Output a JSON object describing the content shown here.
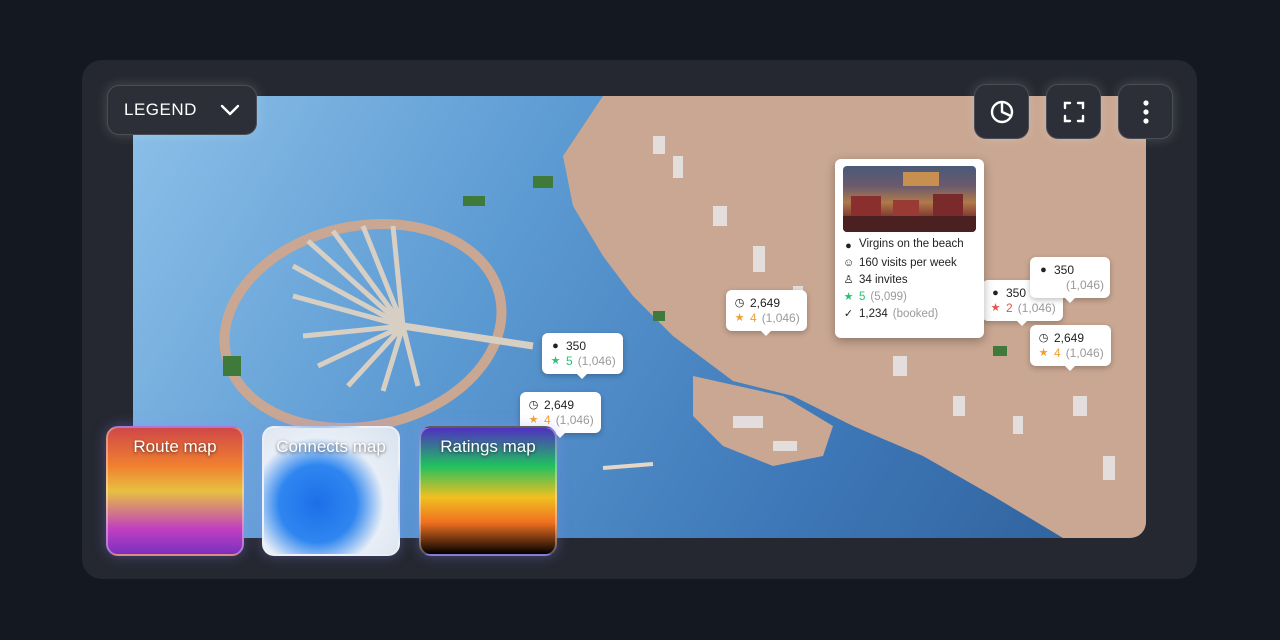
{
  "legend": {
    "label": "LEGEND"
  },
  "toolbar": {
    "stats_icon": "pie-chart-icon",
    "fullscreen_icon": "fullscreen-icon",
    "more_icon": "more-vertical-icon"
  },
  "pins": [
    {
      "value": "350",
      "rating": "5",
      "count": "(1,046)"
    },
    {
      "value": "2,649",
      "rating": "4",
      "count": "(1,046)"
    },
    {
      "value": "2,649",
      "rating": "4",
      "count": "(1,046)"
    },
    {
      "value": "350",
      "rating": "2",
      "count": "(1,046)"
    },
    {
      "value": "350",
      "rating": "",
      "count": "(1,046)"
    },
    {
      "value": "2,649",
      "rating": "4",
      "count": "(1,046)"
    }
  ],
  "place_card": {
    "name": "Virgins on the beach",
    "visits": "160 visits per week",
    "invites": "34 invites",
    "rating": "5",
    "rating_count": "(5,099)",
    "booked_value": "1,234",
    "booked_label": "(booked)"
  },
  "map_types": [
    {
      "label": "Route map"
    },
    {
      "label": "Connects map"
    },
    {
      "label": "Ratings map"
    }
  ],
  "colors": {
    "rating_high": "#2fbf71",
    "rating_mid": "#f0a030",
    "rating_low": "#e5534b"
  }
}
